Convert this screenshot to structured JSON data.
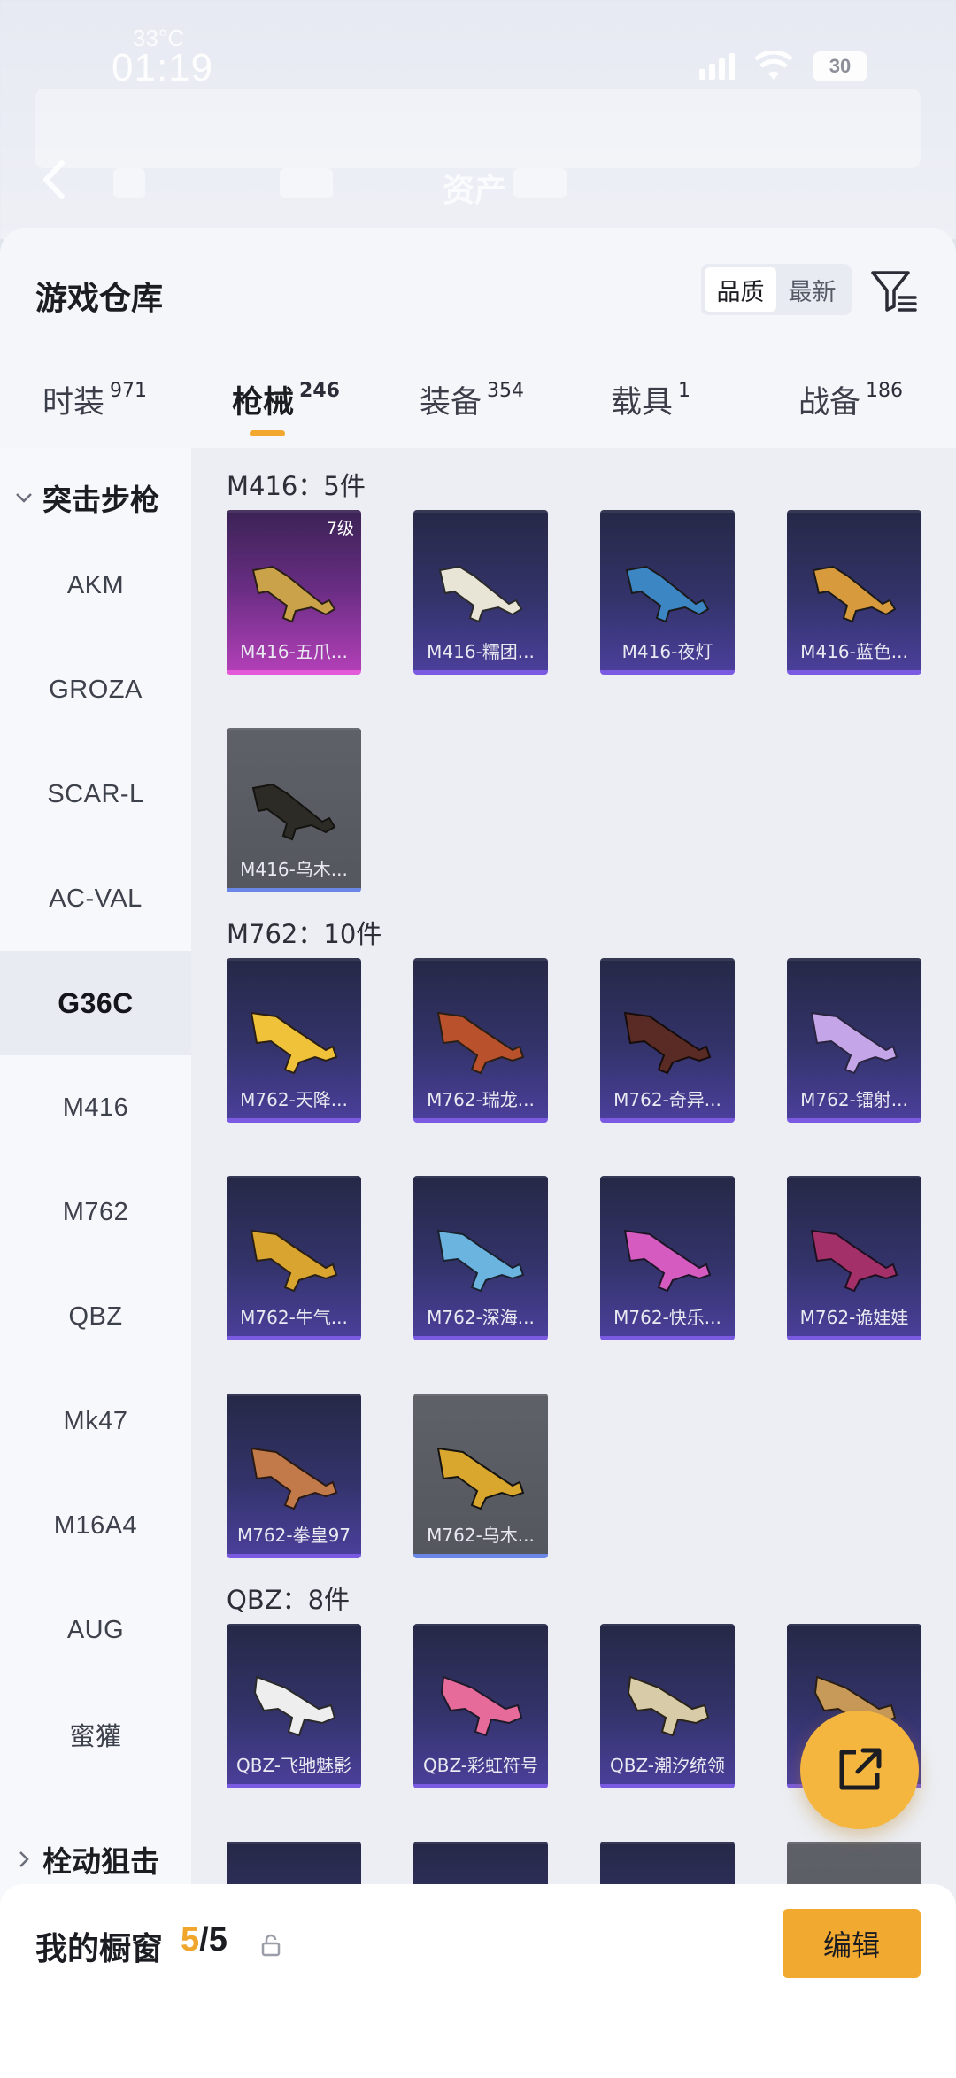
{
  "status_bar": {
    "time": "01:19",
    "sub": "33°C",
    "battery": "30"
  },
  "background": {
    "title": "资产"
  },
  "sheet": {
    "title": "游戏仓库",
    "sort_options": [
      "品质",
      "最新"
    ],
    "sort_selected": "品质"
  },
  "tabs": [
    {
      "label": "时装",
      "count": "971"
    },
    {
      "label": "枪械",
      "count": "246"
    },
    {
      "label": "装备",
      "count": "354"
    },
    {
      "label": "载具",
      "count": "1"
    },
    {
      "label": "战备",
      "count": "186"
    }
  ],
  "active_tab": "枪械",
  "sidebar": {
    "category_open": "突击步枪",
    "items": [
      "AKM",
      "GROZA",
      "SCAR-L",
      "AC-VAL",
      "G36C",
      "M416",
      "M762",
      "QBZ",
      "Mk47",
      "M16A4",
      "AUG",
      "蜜獾"
    ],
    "active_item": "G36C",
    "category_closed": "栓动狙击"
  },
  "sections": [
    {
      "title": "M416：5件",
      "items": [
        {
          "name": "M416-五爪...",
          "level": "7级",
          "rarity": "legendary"
        },
        {
          "name": "M416-糯团...",
          "rarity": "epic"
        },
        {
          "name": "M416-夜灯",
          "rarity": "epic"
        },
        {
          "name": "M416-蓝色...",
          "rarity": "epic"
        },
        {
          "name": "M416-乌木...",
          "rarity": "common"
        }
      ]
    },
    {
      "title": "M762：10件",
      "items": [
        {
          "name": "M762-天降...",
          "rarity": "epic"
        },
        {
          "name": "M762-瑞龙...",
          "rarity": "epic"
        },
        {
          "name": "M762-奇异...",
          "rarity": "epic"
        },
        {
          "name": "M762-镭射...",
          "rarity": "epic"
        },
        {
          "name": "M762-牛气...",
          "rarity": "epic"
        },
        {
          "name": "M762-深海...",
          "rarity": "epic"
        },
        {
          "name": "M762-快乐...",
          "rarity": "epic"
        },
        {
          "name": "M762-诡娃娃",
          "rarity": "epic"
        },
        {
          "name": "M762-拳皇97",
          "rarity": "epic"
        },
        {
          "name": "M762-乌木...",
          "rarity": "common"
        }
      ]
    },
    {
      "title": "QBZ：8件",
      "items": [
        {
          "name": "QBZ-飞驰魅影",
          "rarity": "epic"
        },
        {
          "name": "QBZ-彩虹符号",
          "rarity": "epic"
        },
        {
          "name": "QBZ-潮汐统领",
          "rarity": "epic"
        },
        {
          "name": "Q",
          "rarity": "epic"
        }
      ]
    }
  ],
  "footer": {
    "title": "我的橱窗",
    "count_current": "5",
    "count_total": "/5",
    "edit_label": "编辑"
  },
  "colors": {
    "accent": "#f2a92f",
    "epic": "#7a5ae0",
    "legendary": "#e25ad7",
    "common": "#6a86e6"
  }
}
